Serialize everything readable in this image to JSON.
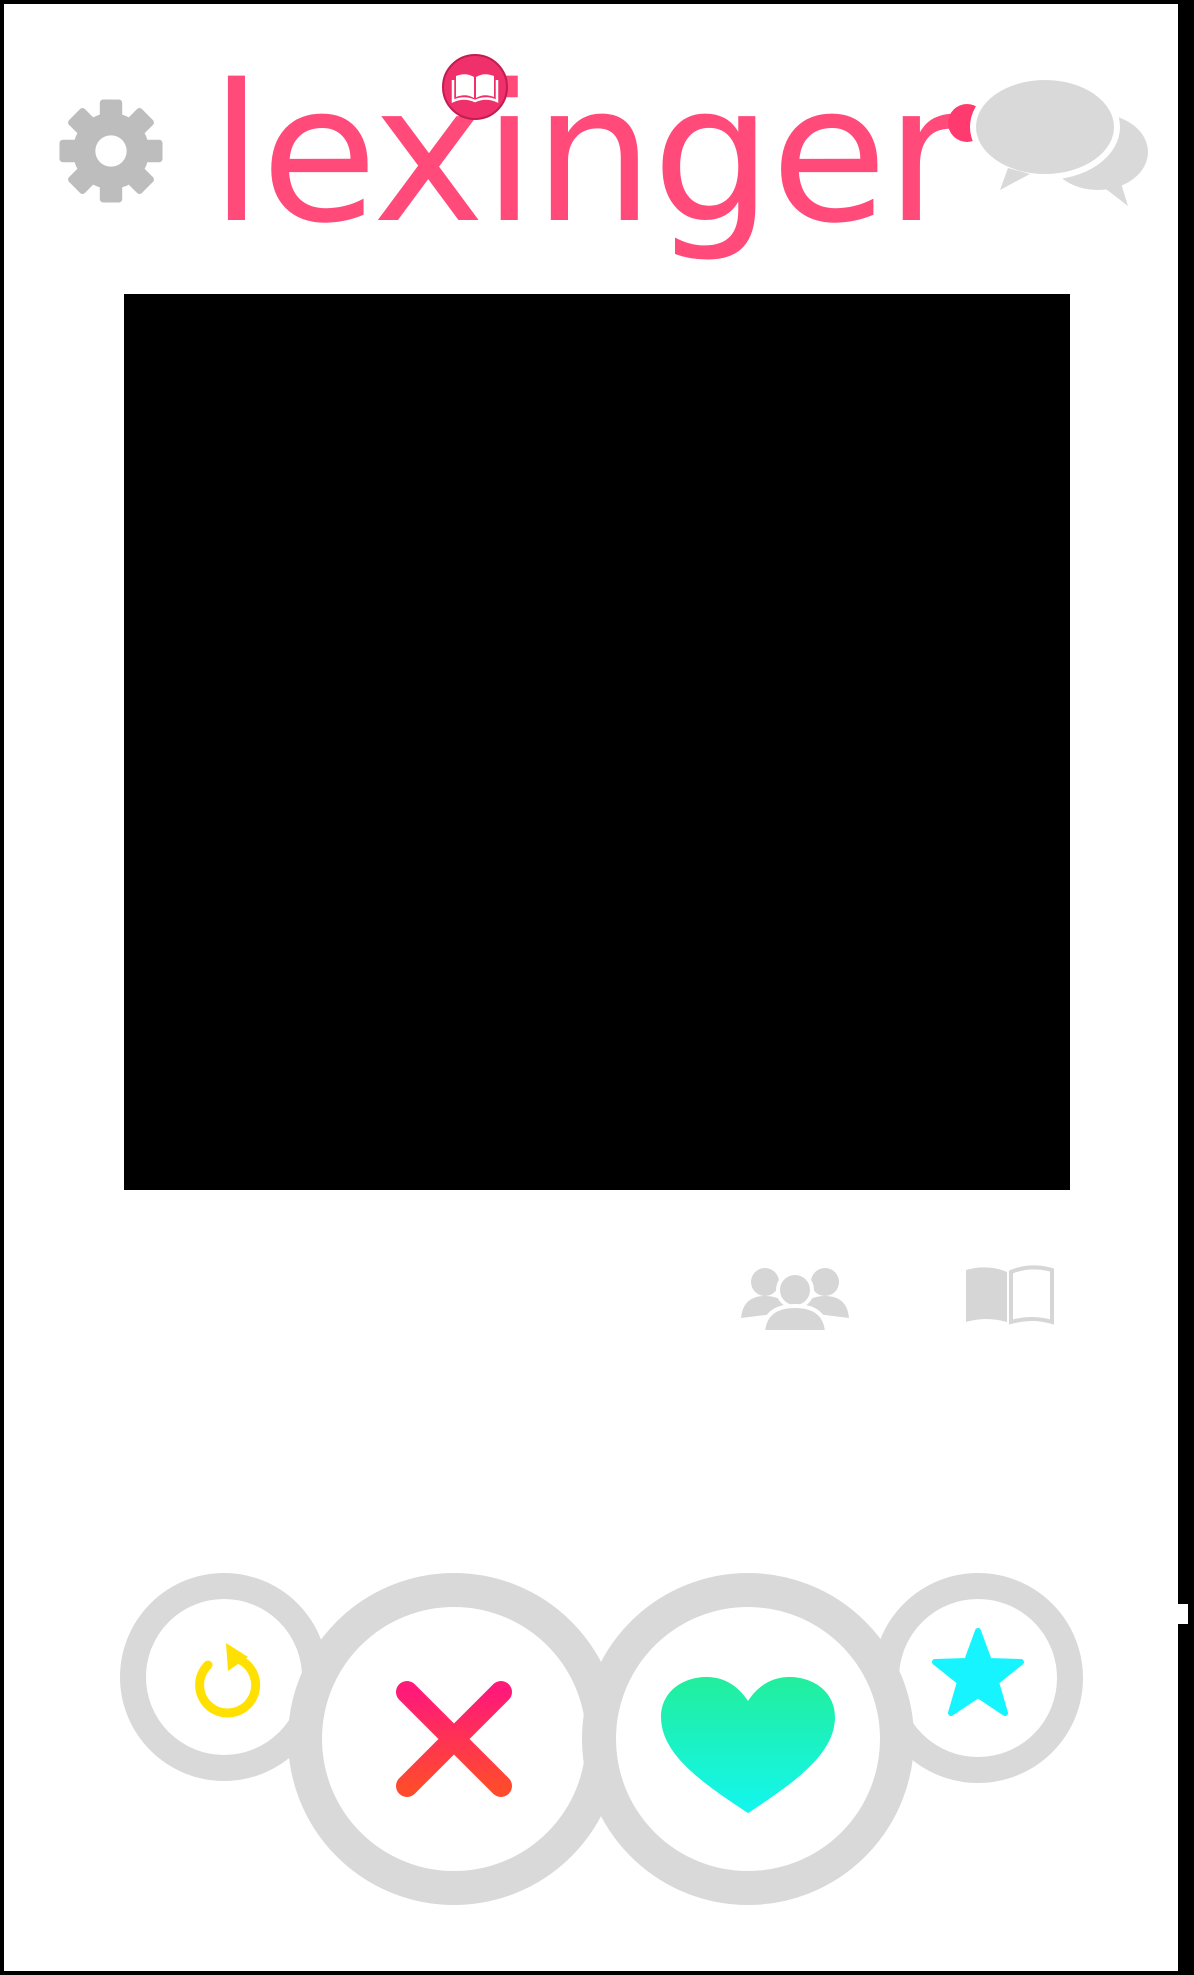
{
  "app": {
    "name": "lexinger",
    "brand_color": "#ff4a7a",
    "badge_icon": "open-book-icon"
  },
  "header": {
    "settings_icon": "gear-icon",
    "messages_icon": "chat-bubbles-icon",
    "notification_dot_color": "#ff3a6e"
  },
  "card": {
    "photo_color": "#000000",
    "icons": [
      "group-icon",
      "book-icon"
    ]
  },
  "actions": [
    {
      "id": "undo",
      "icon": "undo-arrow-icon",
      "color": "#ffe000"
    },
    {
      "id": "nope",
      "icon": "x-icon",
      "color": "#ff2a6d"
    },
    {
      "id": "like",
      "icon": "heart-icon",
      "color": "#1ef0c0"
    },
    {
      "id": "super-like",
      "icon": "star-icon",
      "color": "#16f4ff"
    }
  ]
}
